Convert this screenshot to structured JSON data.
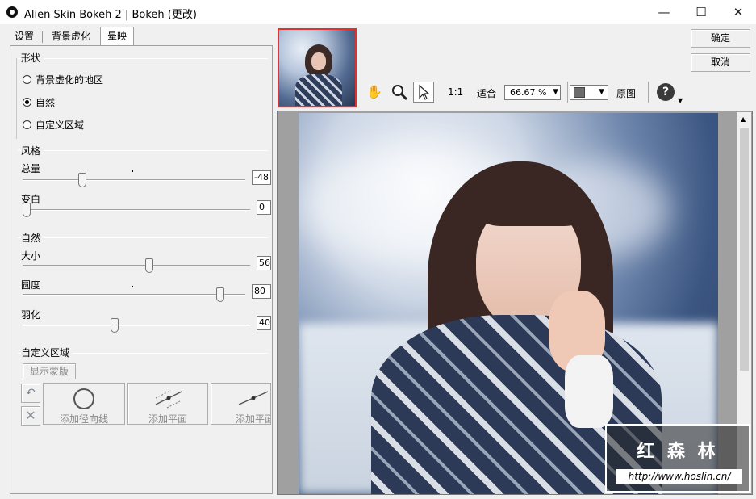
{
  "window": {
    "title": "Alien Skin Bokeh 2 | Bokeh (更改)"
  },
  "tabs": [
    {
      "label": "设置"
    },
    {
      "label": "背景虚化"
    },
    {
      "label": "晕映"
    }
  ],
  "shape": {
    "label": "形状",
    "options": [
      {
        "label": "背景虚化的地区",
        "selected": false
      },
      {
        "label": "自然",
        "selected": true
      },
      {
        "label": "自定义区域",
        "selected": false
      }
    ]
  },
  "style": {
    "label": "风格",
    "amount": {
      "label": "总量",
      "value": "-48"
    },
    "whiten": {
      "label": "变白",
      "value": "0"
    }
  },
  "natural": {
    "label": "自然",
    "size": {
      "label": "大小",
      "value": "56"
    },
    "roundness": {
      "label": "圆度",
      "value": "80"
    },
    "feather": {
      "label": "羽化",
      "value": "40"
    }
  },
  "custom": {
    "label": "自定义区域",
    "show_mask": "显示蒙版",
    "add_radial": "添加径向线",
    "add_plane1": "添加平面",
    "add_plane2": "添加平面"
  },
  "toolbar": {
    "zoom_1to1": "1:1",
    "fit": "适合",
    "zoom_value": "66.67 %",
    "original": "原图"
  },
  "buttons": {
    "ok": "确定",
    "cancel": "取消"
  },
  "watermark": {
    "title": "红 森 林",
    "url": "http://www.hoslin.cn/"
  }
}
